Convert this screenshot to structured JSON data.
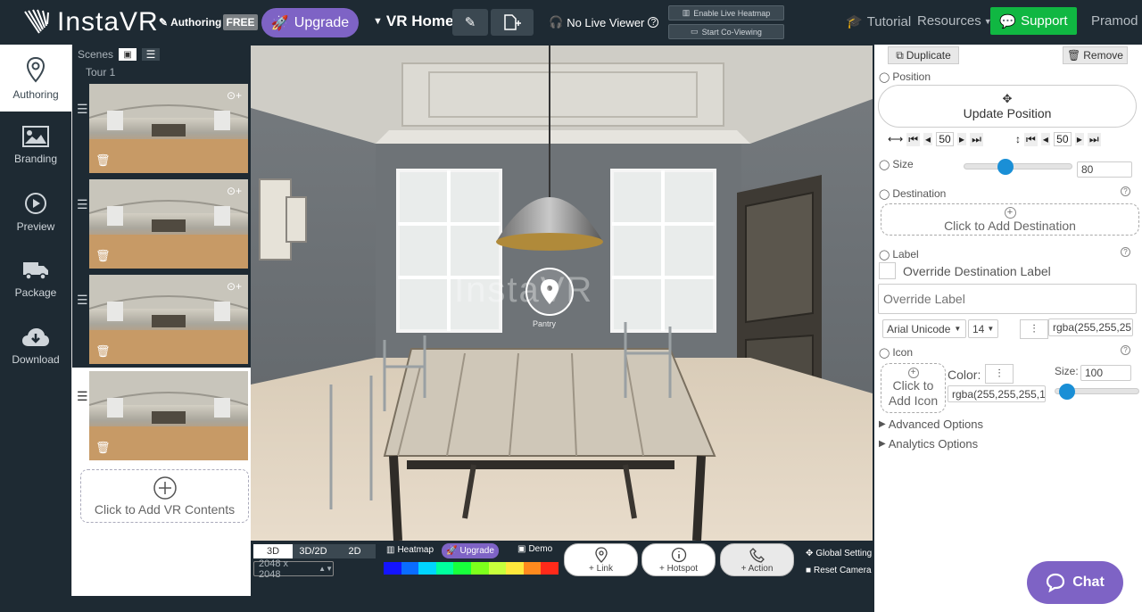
{
  "header": {
    "logo_text": "InstaVR",
    "mode_label": "Authoring",
    "plan_badge": "FREE",
    "upgrade_label": "Upgrade",
    "project_title": "VR Home",
    "live_viewer": "No Live Viewer",
    "heatmap_btn": "Enable Live Heatmap",
    "coview_btn": "Start Co-Viewing",
    "tutorial": "Tutorial",
    "resources": "Resources",
    "support": "Support",
    "user": "Pramod"
  },
  "nav": {
    "items": [
      {
        "label": "Authoring",
        "icon": "map-pin-icon"
      },
      {
        "label": "Branding",
        "icon": "image-icon"
      },
      {
        "label": "Preview",
        "icon": "play-icon"
      },
      {
        "label": "Package",
        "icon": "truck-icon"
      },
      {
        "label": "Download",
        "icon": "cloud-download-icon"
      }
    ]
  },
  "scenes": {
    "title": "Scenes",
    "tour_label": "Tour 1",
    "add_label": "Click to Add VR Contents",
    "count": 4
  },
  "viewer": {
    "watermark": "InstaVR",
    "hotspot_caption": "Pantry"
  },
  "bottom": {
    "modes": [
      "3D",
      "3D/2D",
      "2D"
    ],
    "active_mode": "3D",
    "resolution": "2048 x 2048",
    "heatmap": "Heatmap",
    "upgrade": "Upgrade",
    "demo": "Demo",
    "actions": [
      "+ Link",
      "+ Hotspot",
      "+ Action"
    ],
    "global_settings": "Global Setting",
    "reset_camera": "Reset Camera",
    "heat_colors": [
      "#1414ff",
      "#0a6cff",
      "#00d4ff",
      "#00ff9e",
      "#18ff3c",
      "#7dff1c",
      "#c8ff3c",
      "#ffe83c",
      "#ff8a1e",
      "#ff2a1a"
    ]
  },
  "panel": {
    "duplicate": "Duplicate",
    "remove": "Remove",
    "position": "Position",
    "update_position": "Update Position",
    "h_value": "50",
    "v_value": "50",
    "size": "Size",
    "size_value": "80",
    "size_slider": 0.38,
    "destination": "Destination",
    "add_destination": "Click to Add Destination",
    "label": "Label",
    "override_dest_label": "Override Destination Label",
    "override_placeholder": "Override Label",
    "font": "Arial Unicode",
    "font_size": "14",
    "label_color": "rgba(255,255,25",
    "icon": "Icon",
    "add_icon": "Click to Add Icon",
    "color_label": "Color:",
    "icon_color": "rgba(255,255,255,1",
    "icon_size_label": "Size:",
    "icon_size": "100",
    "icon_slider": 0.14,
    "advanced": "Advanced Options",
    "analytics": "Analytics Options"
  },
  "chat": "Chat"
}
